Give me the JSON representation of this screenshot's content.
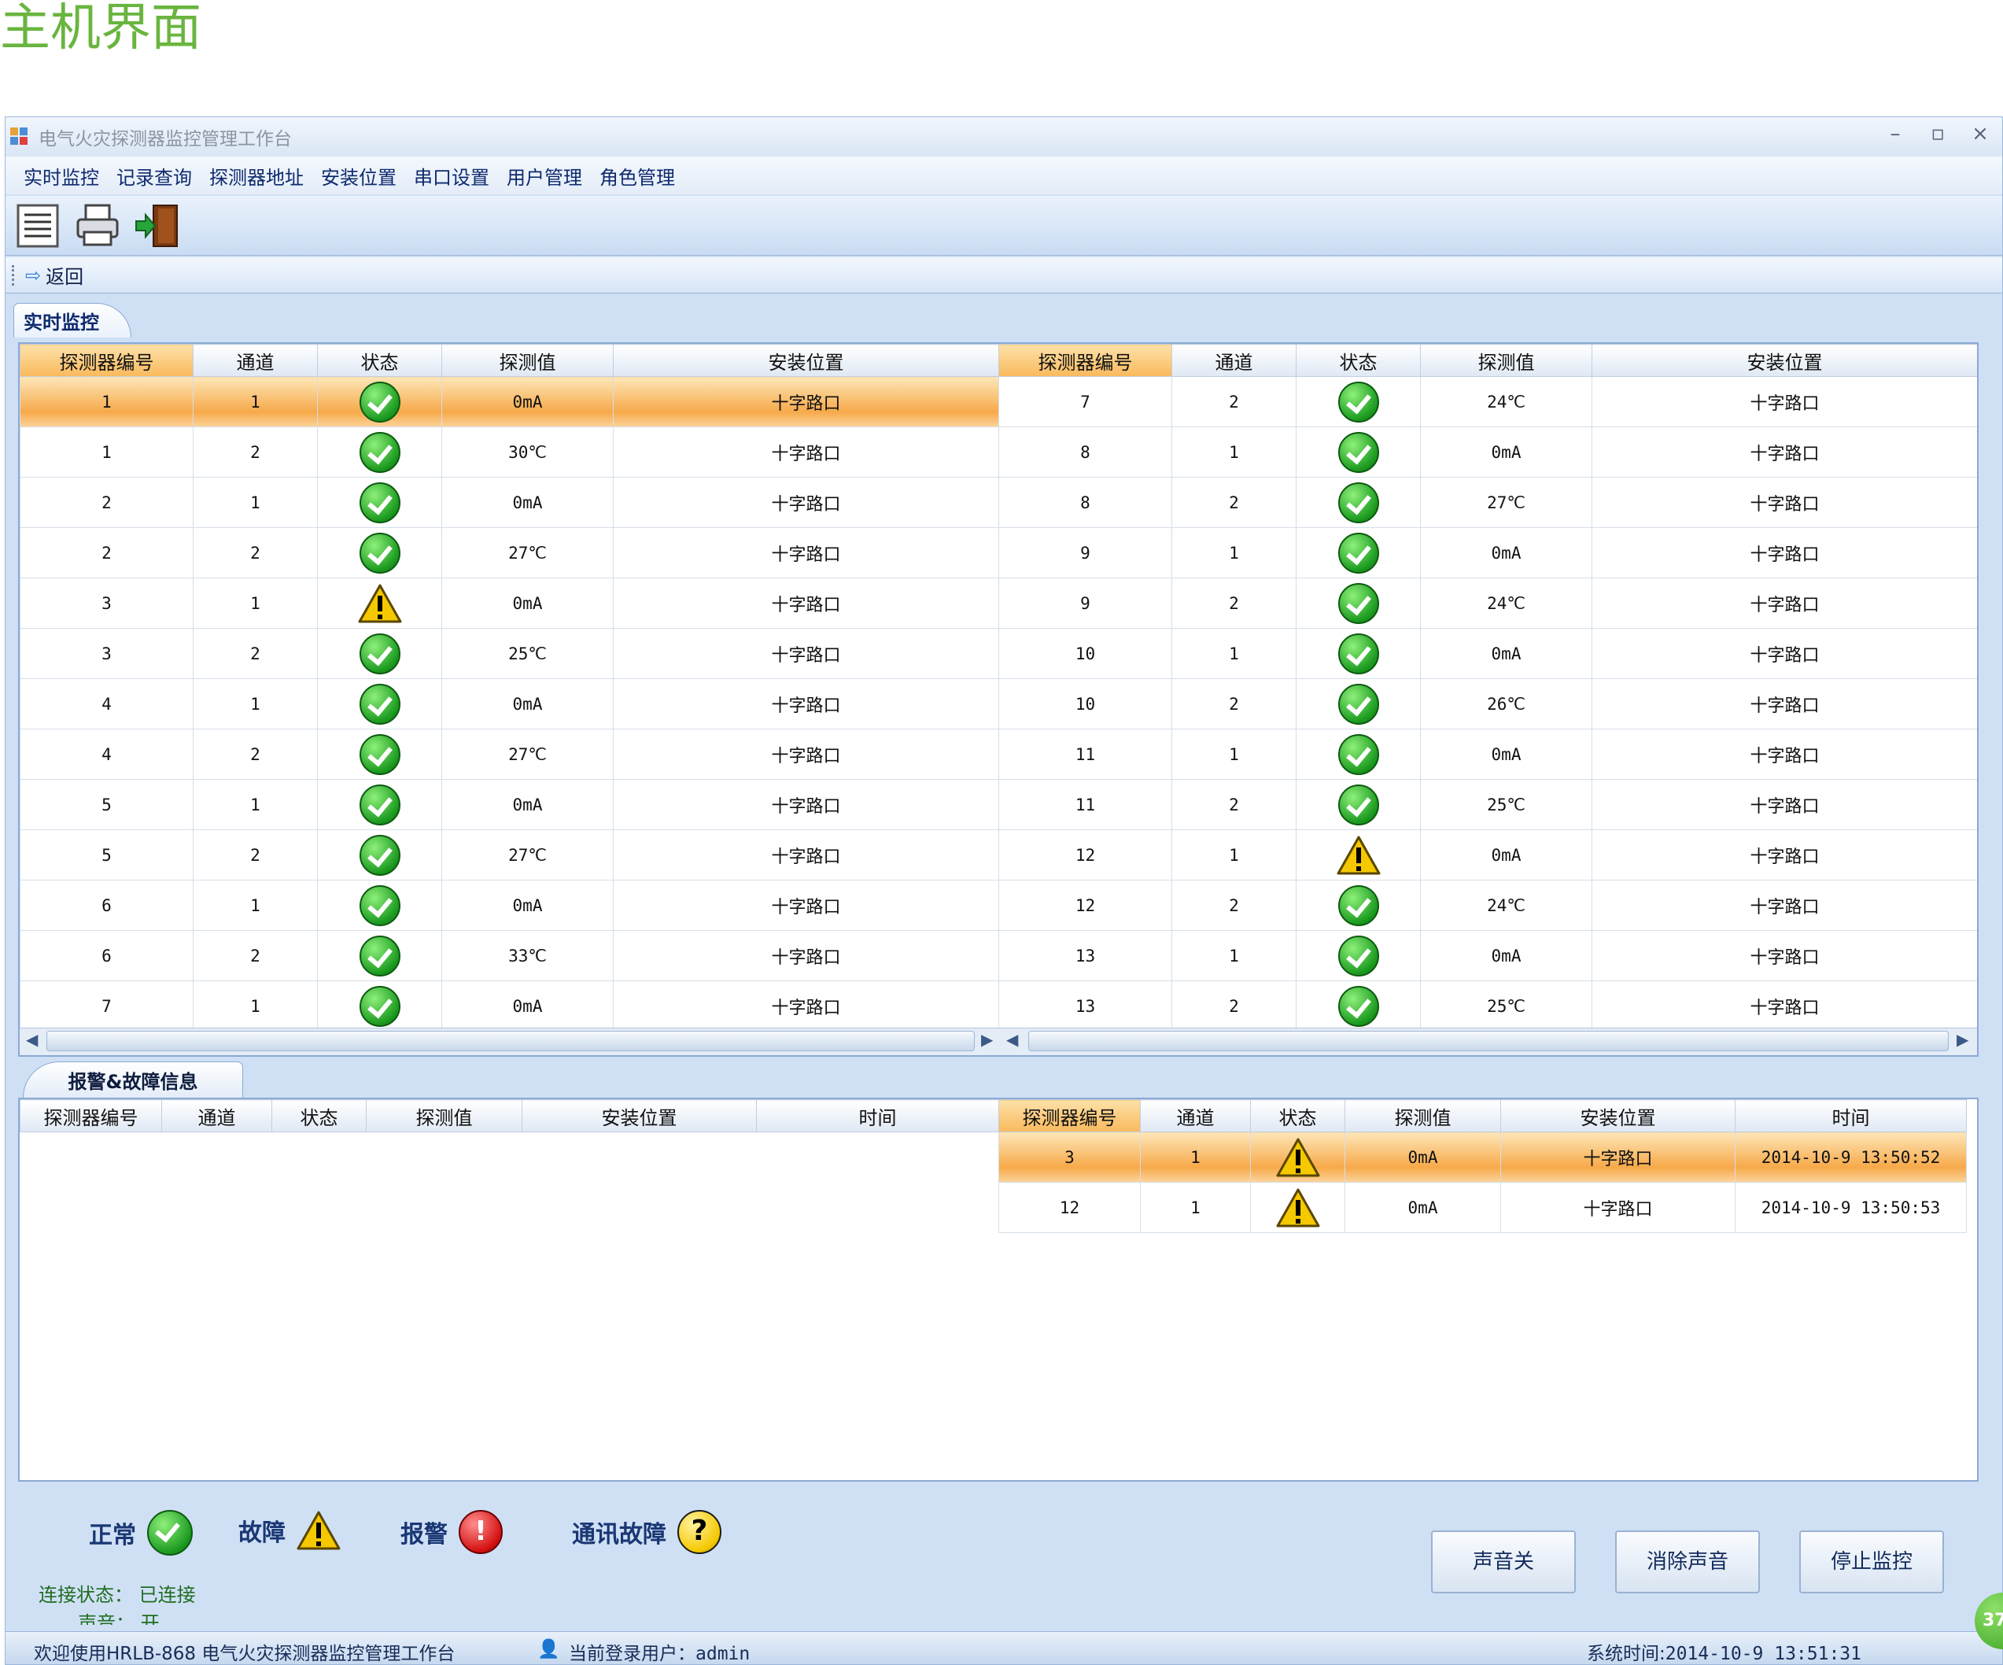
{
  "page_heading": "主机界面",
  "window": {
    "title": "电气火灾探测器监控管理工作台",
    "minimize": "–",
    "restore": "▫",
    "close": "×"
  },
  "menu": [
    "实时监控",
    "记录查询",
    "探测器地址",
    "安装位置",
    "串口设置",
    "用户管理",
    "角色管理"
  ],
  "toolbar": {
    "icons": [
      "list-icon",
      "printer-icon",
      "exit-door-icon"
    ]
  },
  "nav": {
    "back_label": "返回"
  },
  "tab_main": "实时监控",
  "grid_headers": [
    "探测器编号",
    "通道",
    "状态",
    "探测值",
    "安装位置"
  ],
  "grid_left": [
    {
      "id": "1",
      "ch": "1",
      "status": "ok",
      "value": "0mA",
      "loc": "十字路口",
      "selected": true
    },
    {
      "id": "1",
      "ch": "2",
      "status": "ok",
      "value": "30℃",
      "loc": "十字路口"
    },
    {
      "id": "2",
      "ch": "1",
      "status": "ok",
      "value": "0mA",
      "loc": "十字路口"
    },
    {
      "id": "2",
      "ch": "2",
      "status": "ok",
      "value": "27℃",
      "loc": "十字路口"
    },
    {
      "id": "3",
      "ch": "1",
      "status": "warn",
      "value": "0mA",
      "loc": "十字路口"
    },
    {
      "id": "3",
      "ch": "2",
      "status": "ok",
      "value": "25℃",
      "loc": "十字路口"
    },
    {
      "id": "4",
      "ch": "1",
      "status": "ok",
      "value": "0mA",
      "loc": "十字路口"
    },
    {
      "id": "4",
      "ch": "2",
      "status": "ok",
      "value": "27℃",
      "loc": "十字路口"
    },
    {
      "id": "5",
      "ch": "1",
      "status": "ok",
      "value": "0mA",
      "loc": "十字路口"
    },
    {
      "id": "5",
      "ch": "2",
      "status": "ok",
      "value": "27℃",
      "loc": "十字路口"
    },
    {
      "id": "6",
      "ch": "1",
      "status": "ok",
      "value": "0mA",
      "loc": "十字路口"
    },
    {
      "id": "6",
      "ch": "2",
      "status": "ok",
      "value": "33℃",
      "loc": "十字路口"
    },
    {
      "id": "7",
      "ch": "1",
      "status": "ok",
      "value": "0mA",
      "loc": "十字路口"
    }
  ],
  "grid_right": [
    {
      "id": "7",
      "ch": "2",
      "status": "ok",
      "value": "24℃",
      "loc": "十字路口"
    },
    {
      "id": "8",
      "ch": "1",
      "status": "ok",
      "value": "0mA",
      "loc": "十字路口"
    },
    {
      "id": "8",
      "ch": "2",
      "status": "ok",
      "value": "27℃",
      "loc": "十字路口"
    },
    {
      "id": "9",
      "ch": "1",
      "status": "ok",
      "value": "0mA",
      "loc": "十字路口"
    },
    {
      "id": "9",
      "ch": "2",
      "status": "ok",
      "value": "24℃",
      "loc": "十字路口"
    },
    {
      "id": "10",
      "ch": "1",
      "status": "ok",
      "value": "0mA",
      "loc": "十字路口"
    },
    {
      "id": "10",
      "ch": "2",
      "status": "ok",
      "value": "26℃",
      "loc": "十字路口"
    },
    {
      "id": "11",
      "ch": "1",
      "status": "ok",
      "value": "0mA",
      "loc": "十字路口"
    },
    {
      "id": "11",
      "ch": "2",
      "status": "ok",
      "value": "25℃",
      "loc": "十字路口"
    },
    {
      "id": "12",
      "ch": "1",
      "status": "warn",
      "value": "0mA",
      "loc": "十字路口"
    },
    {
      "id": "12",
      "ch": "2",
      "status": "ok",
      "value": "24℃",
      "loc": "十字路口"
    },
    {
      "id": "13",
      "ch": "1",
      "status": "ok",
      "value": "0mA",
      "loc": "十字路口"
    },
    {
      "id": "13",
      "ch": "2",
      "status": "ok",
      "value": "25℃",
      "loc": "十字路口"
    }
  ],
  "tab_alarm": "报警&故障信息",
  "alarm_headers": [
    "探测器编号",
    "通道",
    "状态",
    "探测值",
    "安装位置",
    "时间"
  ],
  "alarm_left": [],
  "alarm_right": [
    {
      "id": "3",
      "ch": "1",
      "status": "warn",
      "value": "0mA",
      "loc": "十字路口",
      "time": "2014-10-9 13:50:52",
      "selected": true
    },
    {
      "id": "12",
      "ch": "1",
      "status": "warn",
      "value": "0mA",
      "loc": "十字路口",
      "time": "2014-10-9 13:50:53"
    }
  ],
  "legend": {
    "normal": "正常",
    "fault": "故障",
    "alarm": "报警",
    "comm_fault": "通讯故障"
  },
  "connection": {
    "label": "连接状态：",
    "value": "已连接"
  },
  "sound": {
    "label": "声音：",
    "value": "开"
  },
  "buttons": {
    "sound_off": "声音关",
    "clear_sound": "消除声音",
    "stop_monitor": "停止监控"
  },
  "statusbar": {
    "welcome": "欢迎使用HRLB-868 电气火灾探测器监控管理工作台",
    "user_label": "当前登录用户：",
    "user": "admin",
    "time_label": "系统时间:",
    "time": "2014-10-9 13:51:31"
  },
  "badge": "37",
  "colors": {
    "heading_green": "#69b53f",
    "selected_orange": "#f7a94a",
    "ok_green": "#1b9a1f",
    "warn_yellow": "#f5c800",
    "alarm_red": "#d41111"
  }
}
